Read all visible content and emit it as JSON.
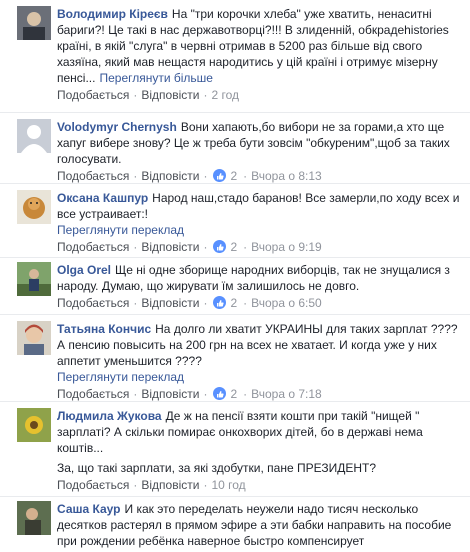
{
  "labels": {
    "like": "Подобається",
    "reply": "Відповісти",
    "translate": "Переглянути переклад",
    "see_more": "Переглянути більше",
    "sep": "·"
  },
  "colors": {
    "link": "#385898",
    "meta": "#90949c",
    "reaction": "#5890ff"
  },
  "comments": [
    {
      "author": "Володимир Кіреєв",
      "text": "На \"три корочки хлеба\" уже хватить, ненаситні бариги?! Це такі в нас державотворці?!!! В злиденній, обкрадеhistories країні, в якій \"слуга\" в червні отримав в 5200 раз більше від свого хазяїна, який мав нещастя народитись у цій країні і отримує мізерну пенсі...",
      "time": "2 год",
      "reactions": null
    },
    {
      "author": "Volodymyr Chernysh",
      "text": "Вони хапають,бо вибори не за горами,а хто ще хапуг вибере знову? Це ж треба бути зовсім \"обкуреним\",щоб за таких голосувати.",
      "time": "Вчора о 8:13",
      "reactions": "2"
    },
    {
      "author": "Оксана Кашпур",
      "text": "Народ наш,стадо баранов! Все замерли,по ходу всех и все устраивает:!",
      "time": "Вчора о 9:19",
      "reactions": "2"
    },
    {
      "author": "Olga Orel",
      "text": "Ще ні одне зборище народних виборців, так не знущалися з народу. Думаю, що жирувати їм залишилось не довго.",
      "time": "Вчора о 6:50",
      "reactions": "2"
    },
    {
      "author": "Татьяна Кончис",
      "text": "На долго ли хватит УКРАИНЫ для таких зарплат ???? А пенсию повысить на 200 грн на всех не хватает. И когда уже у них аппетит уменьшится ????",
      "time": "Вчора о 7:18",
      "reactions": "2"
    },
    {
      "author": "Людмила Жукова",
      "text": "Де ж на пенсії взяти кошти при такій \"нищей \" зарплаті? А скільки помирає онкохворих дітей, бо в державі нема коштів...",
      "text2": "За, що такі зарплати, за які здобутки, пане ПРЕЗИДЕНТ?",
      "time": "10 год",
      "reactions": null
    },
    {
      "author": "Саша Каур",
      "text": "И как это переделать неужели надо тисяч несколько десятков растерял в прямом эфире а эти бабки направить на пособие при рождении ребёнка наверное быстро компенсирует",
      "time": "",
      "reactions": null
    }
  ]
}
